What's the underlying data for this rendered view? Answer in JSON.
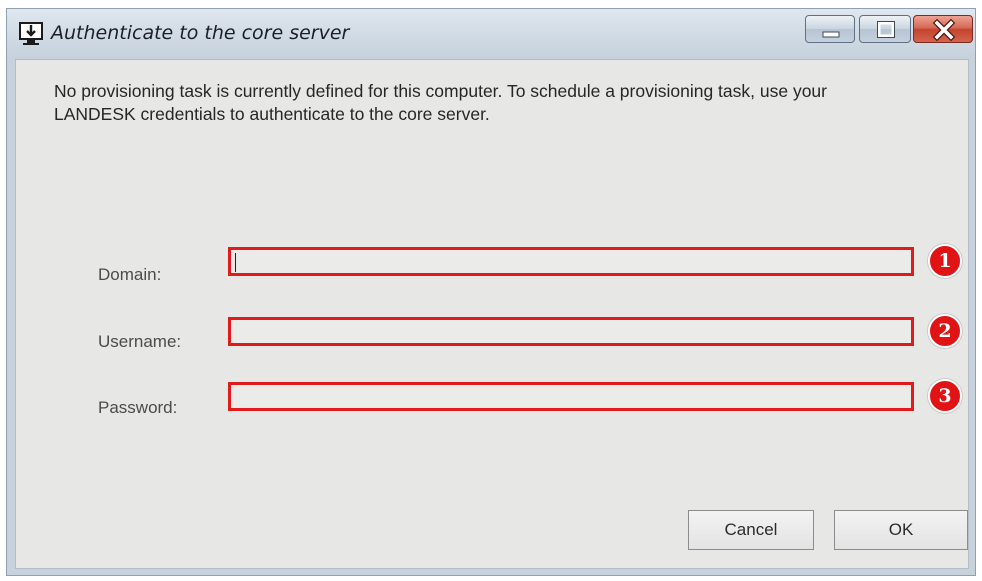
{
  "window": {
    "title": "Authenticate to the core server",
    "icon": "download-monitor-icon",
    "controls": [
      "minimize-icon",
      "maximize-icon",
      "close-icon"
    ]
  },
  "message": {
    "line1": "No provisioning task is currently defined for this computer.  To schedule a provisioning task, use your",
    "line2": "LANDESK credentials to authenticate to the core server."
  },
  "form": {
    "domain": {
      "label": "Domain:",
      "value": "",
      "badge": "1"
    },
    "username": {
      "label": "Username:",
      "value": "",
      "badge": "2"
    },
    "password": {
      "label": "Password:",
      "value": "",
      "badge": "3"
    }
  },
  "buttons": {
    "cancel": "Cancel",
    "ok": "OK"
  },
  "colors": {
    "highlight": "#e11b1b",
    "badge": "#e01414",
    "titlebar": "#cfd9e3",
    "close_button": "#c2442f"
  }
}
